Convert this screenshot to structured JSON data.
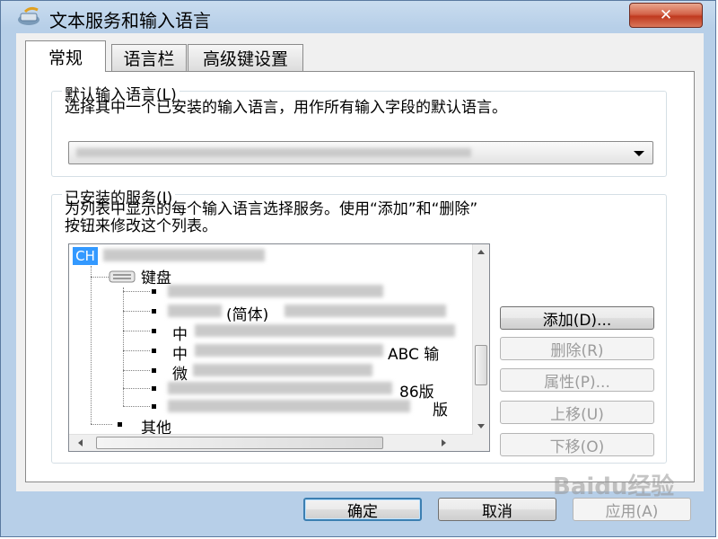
{
  "window": {
    "title": "文本服务和输入语言",
    "close_label": "✕"
  },
  "tabs": [
    {
      "label": "常规",
      "active": true
    },
    {
      "label": "语言栏",
      "active": false
    },
    {
      "label": "高级键设置",
      "active": false
    }
  ],
  "default_language": {
    "group_label": "默认输入语言(L)",
    "description": "选择其中一个已安装的输入语言，用作所有输入字段的默认语言。",
    "selected_value": ""
  },
  "installed_services": {
    "group_label": "已安装的服务(I)",
    "description_line1": "为列表中显示的每个输入语言选择服务。使用“添加”和“删除”",
    "description_line2": "按钮来修改这个列表。",
    "tree": {
      "language_code": "CH",
      "keyboard_label": "键盘",
      "visible_fragments": [
        "(简体)",
        "中",
        "中",
        "ABC 输",
        "微",
        "86版",
        "版"
      ],
      "other_label": "其他"
    },
    "buttons": {
      "add": "添加(D)...",
      "remove": "删除(R)",
      "properties": "属性(P)...",
      "move_up": "上移(U)",
      "move_down": "下移(O)"
    }
  },
  "footer": {
    "ok": "确定",
    "cancel": "取消",
    "apply": "应用(A)"
  },
  "watermark": "Baidu经验",
  "colors": {
    "title_bar": "#b7cfe8",
    "close_button": "#c0391f",
    "selection": "#3399ff"
  }
}
